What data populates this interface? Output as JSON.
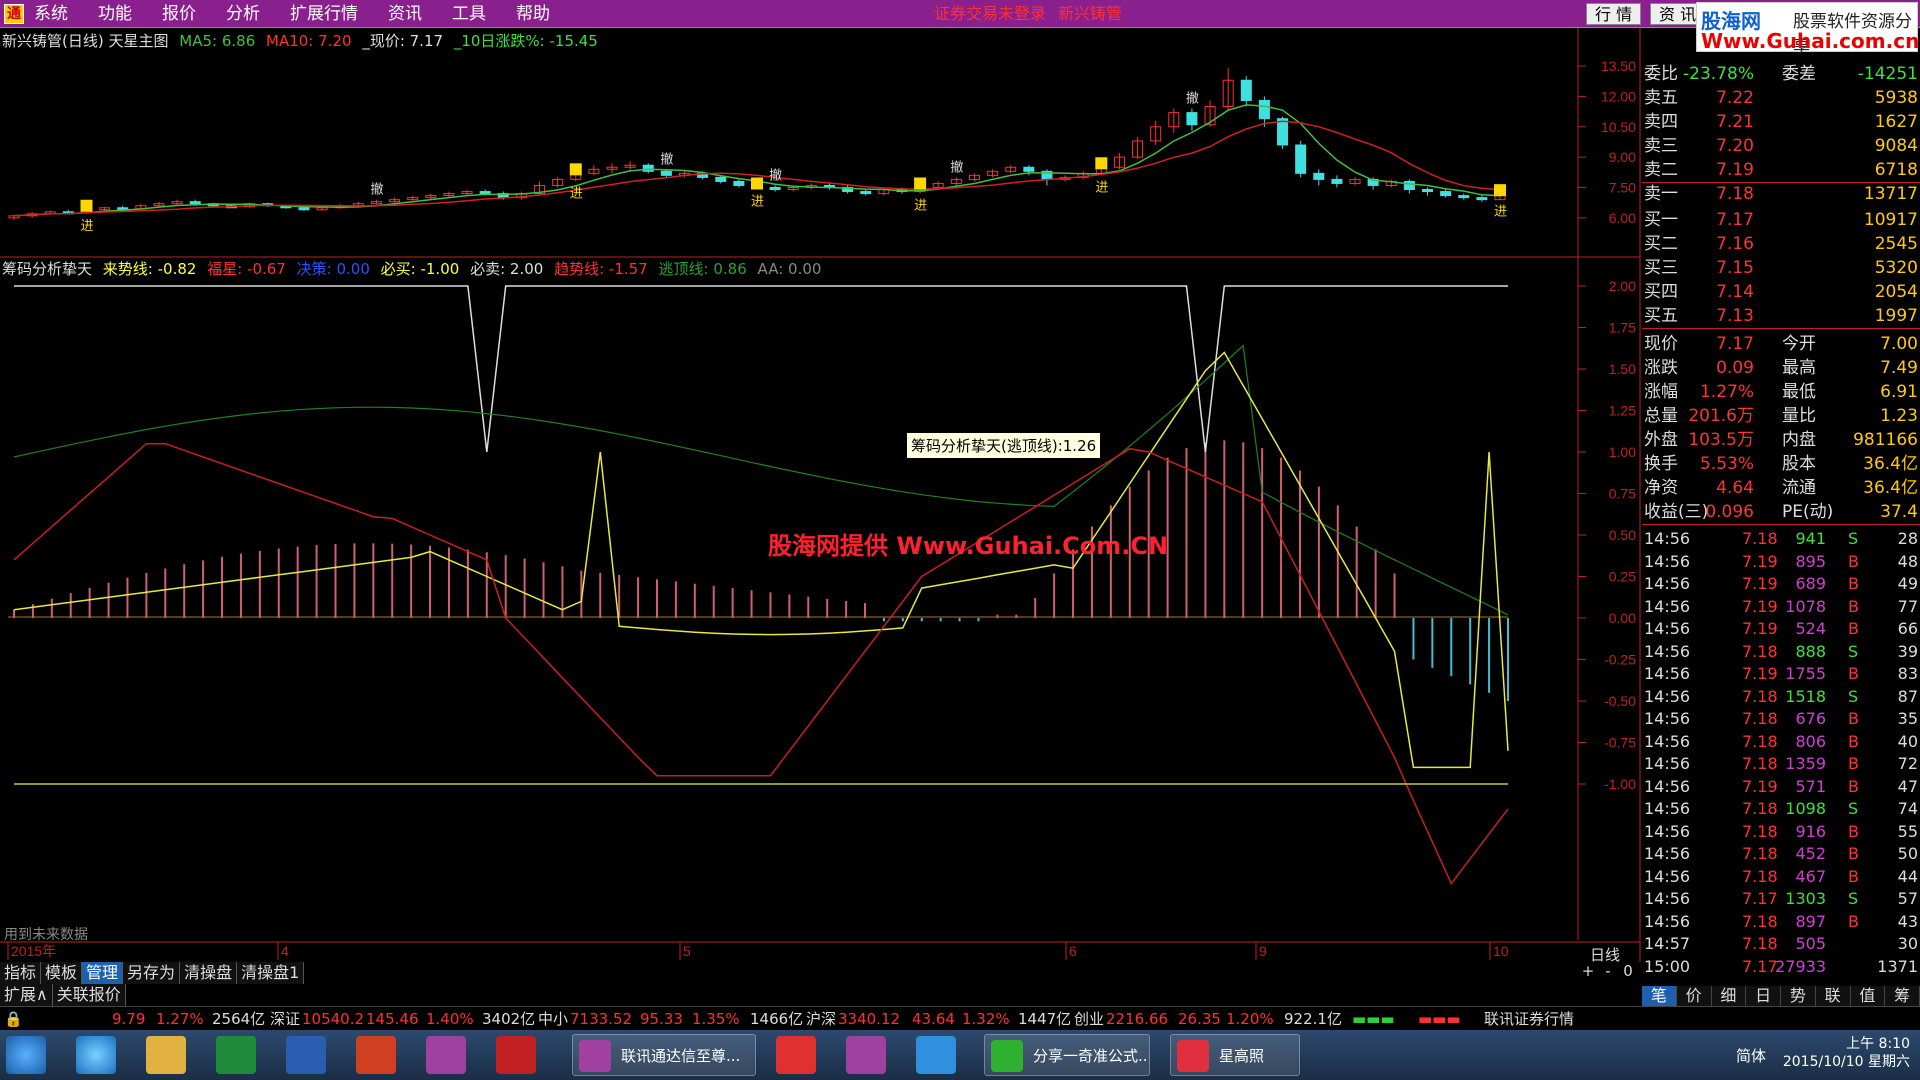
{
  "menubar": {
    "menus": [
      "系统",
      "功能",
      "报价",
      "分析",
      "扩展行情",
      "资讯",
      "工具",
      "帮助"
    ],
    "notice1": "证券交易未登录",
    "notice2": "新兴铸管",
    "btn_quote": "行 情",
    "btn_info": "资 讯",
    "brand_name": "股海网",
    "brand_slogan": "股票软件资源分享",
    "brand_url": "Www.Guhai.com.cn"
  },
  "kline": {
    "title": "新兴铸管(日线) 天星主图",
    "ma5": "MA5: 6.86",
    "ma10": "MA10: 7.20",
    "price": "_现价: 7.17",
    "change10": "_10日涨跌%: -15.45",
    "y_ticks": [
      "13.50",
      "12.00",
      "10.50",
      "9.00",
      "7.50",
      "6.00"
    ],
    "labels": {
      "buy": "进",
      "sell": "撤"
    },
    "candles": [
      [
        6.0,
        6.1,
        5.9,
        6.15
      ],
      [
        6.1,
        6.2,
        6.0,
        6.3
      ],
      [
        6.2,
        6.3,
        6.15,
        6.35
      ],
      [
        6.3,
        6.25,
        6.2,
        6.4
      ],
      [
        6.25,
        6.4,
        6.2,
        6.45
      ],
      [
        6.4,
        6.5,
        6.35,
        6.55
      ],
      [
        6.5,
        6.45,
        6.4,
        6.6
      ],
      [
        6.45,
        6.6,
        6.4,
        6.7
      ],
      [
        6.6,
        6.7,
        6.55,
        6.8
      ],
      [
        6.7,
        6.8,
        6.65,
        6.9
      ],
      [
        6.8,
        6.7,
        6.6,
        6.9
      ],
      [
        6.7,
        6.6,
        6.55,
        6.75
      ],
      [
        6.6,
        6.55,
        6.5,
        6.7
      ],
      [
        6.55,
        6.7,
        6.5,
        6.75
      ],
      [
        6.7,
        6.6,
        6.55,
        6.75
      ],
      [
        6.6,
        6.5,
        6.45,
        6.65
      ],
      [
        6.5,
        6.4,
        6.35,
        6.55
      ],
      [
        6.4,
        6.5,
        6.35,
        6.6
      ],
      [
        6.5,
        6.6,
        6.45,
        6.7
      ],
      [
        6.6,
        6.7,
        6.55,
        6.8
      ],
      [
        6.7,
        6.8,
        6.65,
        6.9
      ],
      [
        6.8,
        6.9,
        6.75,
        7.0
      ],
      [
        6.9,
        7.0,
        6.85,
        7.1
      ],
      [
        7.0,
        7.1,
        6.9,
        7.2
      ],
      [
        7.1,
        7.2,
        7.0,
        7.3
      ],
      [
        7.2,
        7.3,
        7.1,
        7.4
      ],
      [
        7.3,
        7.2,
        7.1,
        7.4
      ],
      [
        7.2,
        7.0,
        6.9,
        7.3
      ],
      [
        7.0,
        7.2,
        6.9,
        7.3
      ],
      [
        7.2,
        7.6,
        7.1,
        7.8
      ],
      [
        7.6,
        7.9,
        7.5,
        8.0
      ],
      [
        7.9,
        8.2,
        7.8,
        8.3
      ],
      [
        8.2,
        8.4,
        8.1,
        8.6
      ],
      [
        8.4,
        8.5,
        8.2,
        8.7
      ],
      [
        8.5,
        8.6,
        8.3,
        8.8
      ],
      [
        8.6,
        8.3,
        8.2,
        8.7
      ],
      [
        8.3,
        8.1,
        8.0,
        8.4
      ],
      [
        8.1,
        8.2,
        8.0,
        8.3
      ],
      [
        8.2,
        8.0,
        7.9,
        8.3
      ],
      [
        8.0,
        7.8,
        7.7,
        8.1
      ],
      [
        7.8,
        7.6,
        7.5,
        7.9
      ],
      [
        7.6,
        7.5,
        7.4,
        7.7
      ],
      [
        7.5,
        7.4,
        7.3,
        7.6
      ],
      [
        7.4,
        7.5,
        7.3,
        7.6
      ],
      [
        7.5,
        7.6,
        7.4,
        7.7
      ],
      [
        7.6,
        7.5,
        7.4,
        7.7
      ],
      [
        7.5,
        7.3,
        7.2,
        7.6
      ],
      [
        7.3,
        7.2,
        7.1,
        7.4
      ],
      [
        7.2,
        7.4,
        7.1,
        7.5
      ],
      [
        7.4,
        7.3,
        7.2,
        7.5
      ],
      [
        7.3,
        7.5,
        7.2,
        7.6
      ],
      [
        7.5,
        7.7,
        7.4,
        7.8
      ],
      [
        7.7,
        7.9,
        7.6,
        8.0
      ],
      [
        7.9,
        8.1,
        7.8,
        8.2
      ],
      [
        8.1,
        8.3,
        8.0,
        8.4
      ],
      [
        8.3,
        8.5,
        8.2,
        8.6
      ],
      [
        8.5,
        8.3,
        8.1,
        8.6
      ],
      [
        8.3,
        7.9,
        7.6,
        8.4
      ],
      [
        7.9,
        8.0,
        7.8,
        8.1
      ],
      [
        8.0,
        8.2,
        7.9,
        8.3
      ],
      [
        8.2,
        8.5,
        8.1,
        8.6
      ],
      [
        8.5,
        9.0,
        8.4,
        9.2
      ],
      [
        9.0,
        9.8,
        8.9,
        10.0
      ],
      [
        9.8,
        10.5,
        9.6,
        10.8
      ],
      [
        10.5,
        11.2,
        10.2,
        11.4
      ],
      [
        11.2,
        10.6,
        10.3,
        11.4
      ],
      [
        10.6,
        11.5,
        10.5,
        11.8
      ],
      [
        11.5,
        12.8,
        11.3,
        13.4
      ],
      [
        12.8,
        11.8,
        11.5,
        13.0
      ],
      [
        11.8,
        10.9,
        10.5,
        12.0
      ],
      [
        10.9,
        9.6,
        9.4,
        11.0
      ],
      [
        9.6,
        8.2,
        8.0,
        9.8
      ],
      [
        8.2,
        7.9,
        7.6,
        8.4
      ],
      [
        7.9,
        7.7,
        7.5,
        8.1
      ],
      [
        7.7,
        7.9,
        7.6,
        8.0
      ],
      [
        7.9,
        7.6,
        7.4,
        8.0
      ],
      [
        7.6,
        7.8,
        7.5,
        7.9
      ],
      [
        7.8,
        7.4,
        7.2,
        7.9
      ],
      [
        7.4,
        7.3,
        7.1,
        7.5
      ],
      [
        7.3,
        7.1,
        7.0,
        7.4
      ],
      [
        7.1,
        7.0,
        6.9,
        7.2
      ],
      [
        7.0,
        6.9,
        6.8,
        7.1
      ],
      [
        6.9,
        7.17,
        6.91,
        7.49
      ]
    ]
  },
  "indicator": {
    "name": "筹码分析挚天",
    "laishi": "来势线: -0.82",
    "fuxing": "福星: -0.67",
    "jueze": "决策: 0.00",
    "bimai": "必买: -1.00",
    "bimai2": "必卖: 2.00",
    "qushi": "趋势线: -1.57",
    "taoding": "逃顶线: 0.86",
    "aa": "AA: 0.00",
    "y_ticks": [
      "2.00",
      "1.75",
      "1.50",
      "1.25",
      "1.00",
      "0.75",
      "0.50",
      "0.25",
      "0.00",
      "-0.25",
      "-0.50",
      "-0.75",
      "-1.00"
    ],
    "tooltip": "筹码分析挚天(逃顶线):1.26",
    "future_note": "用到未来数据"
  },
  "watermark": "股海网提供 Www.Guhai.Com.CN",
  "xaxis": {
    "labels": [
      "2015年",
      "4",
      "5",
      "6",
      "9",
      "10"
    ],
    "period": "日线"
  },
  "bottom_tabs": [
    "指标",
    "模板",
    "管理",
    "另存为",
    "清操盘",
    "清操盘1"
  ],
  "bottom_tabs2": [
    "扩展∧",
    "关联报价"
  ],
  "zoom": [
    "+",
    "-",
    "0"
  ],
  "quote": {
    "weibi_label": "委比",
    "weibi": "-23.78%",
    "weicha_label": "委差",
    "weicha": "-14251",
    "asks": [
      [
        "卖五",
        "7.22",
        "5938"
      ],
      [
        "卖四",
        "7.21",
        "1627"
      ],
      [
        "卖三",
        "7.20",
        "9084"
      ],
      [
        "卖二",
        "7.19",
        "6718"
      ],
      [
        "卖一",
        "7.18",
        "13717"
      ]
    ],
    "bids": [
      [
        "买一",
        "7.17",
        "10917"
      ],
      [
        "买二",
        "7.16",
        "2545"
      ],
      [
        "买三",
        "7.15",
        "5320"
      ],
      [
        "买四",
        "7.14",
        "2054"
      ],
      [
        "买五",
        "7.13",
        "1997"
      ]
    ],
    "stats": [
      [
        "现价",
        "7.17",
        "今开",
        "7.00"
      ],
      [
        "涨跌",
        "0.09",
        "最高",
        "7.49"
      ],
      [
        "涨幅",
        "1.27%",
        "最低",
        "6.91"
      ],
      [
        "总量",
        "201.6万",
        "量比",
        "1.23"
      ],
      [
        "外盘",
        "103.5万",
        "内盘",
        "981166"
      ],
      [
        "换手",
        "5.53%",
        "股本",
        "36.4亿"
      ],
      [
        "净资",
        "4.64",
        "流通",
        "36.4亿"
      ],
      [
        "收益(三)",
        "0.096",
        "PE(动)",
        "37.4"
      ]
    ],
    "ticks": [
      [
        "14:56",
        "7.18",
        "941",
        "S",
        "28"
      ],
      [
        "14:56",
        "7.19",
        "895",
        "B",
        "48"
      ],
      [
        "14:56",
        "7.19",
        "689",
        "B",
        "49"
      ],
      [
        "14:56",
        "7.19",
        "1078",
        "B",
        "77"
      ],
      [
        "14:56",
        "7.19",
        "524",
        "B",
        "66"
      ],
      [
        "14:56",
        "7.18",
        "888",
        "S",
        "39"
      ],
      [
        "14:56",
        "7.19",
        "1755",
        "B",
        "83"
      ],
      [
        "14:56",
        "7.18",
        "1518",
        "S",
        "87"
      ],
      [
        "14:56",
        "7.18",
        "676",
        "B",
        "35"
      ],
      [
        "14:56",
        "7.18",
        "806",
        "B",
        "40"
      ],
      [
        "14:56",
        "7.18",
        "1359",
        "B",
        "72"
      ],
      [
        "14:56",
        "7.19",
        "571",
        "B",
        "47"
      ],
      [
        "14:56",
        "7.18",
        "1098",
        "S",
        "74"
      ],
      [
        "14:56",
        "7.18",
        "916",
        "B",
        "55"
      ],
      [
        "14:56",
        "7.18",
        "452",
        "B",
        "50"
      ],
      [
        "14:56",
        "7.18",
        "467",
        "B",
        "44"
      ],
      [
        "14:56",
        "7.17",
        "1303",
        "S",
        "57"
      ],
      [
        "14:56",
        "7.18",
        "897",
        "B",
        "43"
      ],
      [
        "14:57",
        "7.18",
        "505",
        "",
        "30"
      ],
      [
        "15:00",
        "7.17",
        "27933",
        "",
        "1371"
      ]
    ]
  },
  "right_tabs": [
    "笔",
    "价",
    "细",
    "日",
    "势",
    "联",
    "值",
    "筹"
  ],
  "status": {
    "seg1": "9.79",
    "seg1b": "1.27%",
    "seg1c": "2564亿",
    "sz_label": "深证",
    "sz": "10540.2",
    "sz_ch": "145.46",
    "sz_pct": "1.40%",
    "sz_amt": "3402亿",
    "zx_label": "中小",
    "zx": "7133.52",
    "zx_ch": "95.33",
    "zx_pct": "1.35%",
    "zx_amt": "1466亿",
    "hs_label": "沪深",
    "hs": "3340.12",
    "hs_ch": "43.64",
    "hs_pct": "1.32%",
    "hs_amt": "1447亿",
    "cy_label": "创业",
    "cy": "2216.66",
    "cy_ch": "26.35",
    "cy_pct": "1.20%",
    "cy_amt": "922.1亿",
    "broker": "联讯证券行情"
  },
  "taskbar": {
    "app1": "联讯通达信至尊...",
    "app2": "分享一奇准公式...",
    "app3": "星高照",
    "ime": "简体",
    "time": "上午 8:10",
    "date": "2015/10/10 星期六"
  },
  "colors": {
    "up": "#ff3030",
    "down": "#40e0e0",
    "ma5": "#40c040",
    "ma10": "#d02020",
    "accent": "#ffd700"
  }
}
